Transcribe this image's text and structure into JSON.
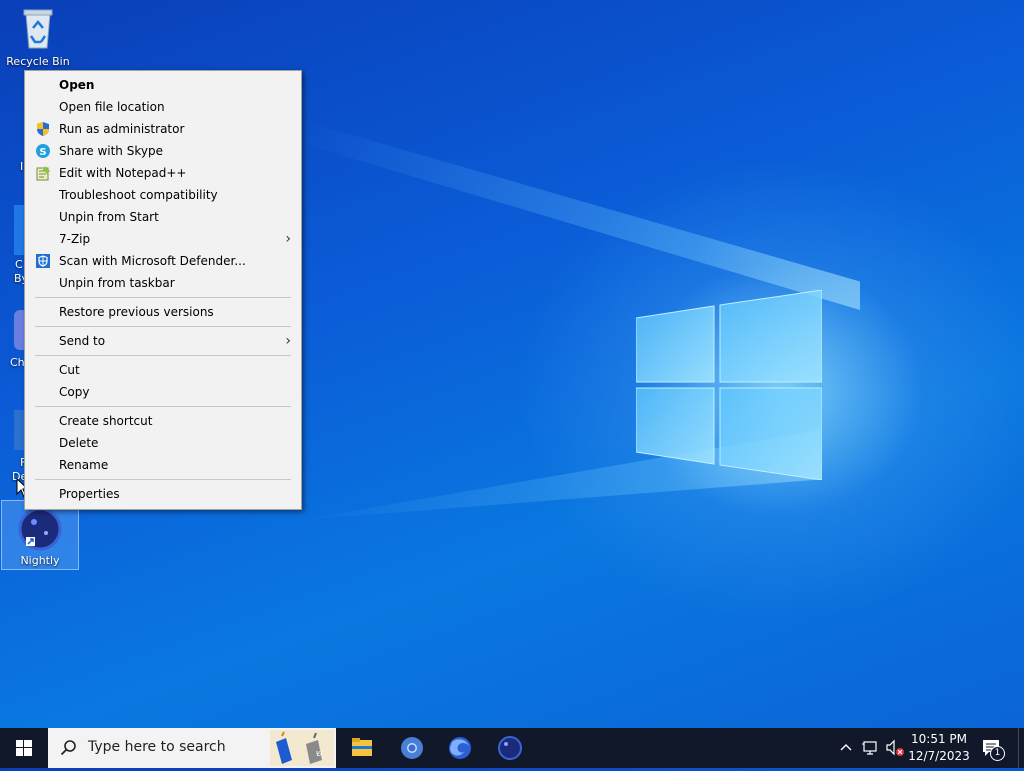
{
  "desktop": {
    "icons": [
      {
        "label": "Recycle Bin"
      },
      {
        "label": "Nightly"
      }
    ],
    "partial_labels": [
      "I",
      "C",
      "By",
      "Ch",
      "F",
      "De"
    ]
  },
  "context_menu": {
    "items": [
      {
        "label": "Open",
        "bold": true
      },
      {
        "label": "Open file location"
      },
      {
        "label": "Run as administrator",
        "icon": "uac-shield-icon"
      },
      {
        "label": "Share with Skype",
        "icon": "skype-icon"
      },
      {
        "label": "Edit with Notepad++",
        "icon": "notepadpp-icon"
      },
      {
        "label": "Troubleshoot compatibility"
      },
      {
        "label": "Unpin from Start"
      },
      {
        "label": "7-Zip",
        "submenu": true
      },
      {
        "label": "Scan with Microsoft Defender...",
        "icon": "defender-icon"
      },
      {
        "label": "Unpin from taskbar"
      },
      {
        "label": "Restore previous versions"
      },
      {
        "label": "Send to",
        "submenu": true
      },
      {
        "label": "Cut"
      },
      {
        "label": "Copy"
      },
      {
        "label": "Create shortcut"
      },
      {
        "label": "Delete"
      },
      {
        "label": "Rename"
      },
      {
        "label": "Properties"
      }
    ],
    "submenu_arrow": "›"
  },
  "taskbar": {
    "search_placeholder": "Type here to search",
    "pinned_apps": [
      "file-explorer-icon",
      "chrome-icon",
      "firefox-icon",
      "firefox-nightly-icon"
    ],
    "time": "10:51 PM",
    "date": "12/7/2023",
    "notification_count": "1"
  }
}
